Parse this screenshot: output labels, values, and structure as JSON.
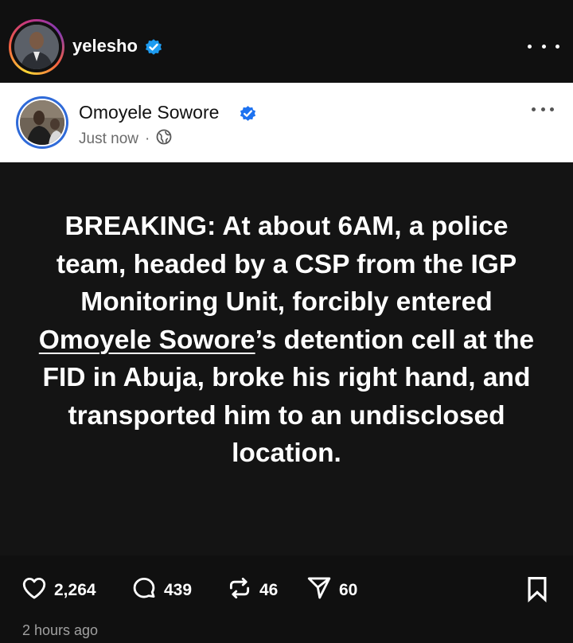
{
  "header": {
    "username": "yelesho",
    "verified": true
  },
  "embedded_post": {
    "author": "Omoyele Sowore",
    "verified": true,
    "time": "Just now",
    "separator": "·",
    "privacy_icon": "globe-icon"
  },
  "post": {
    "text_before": "BREAKING: At about 6AM, a police team, headed by a CSP from the IGP Monitoring Unit, forcibly entered ",
    "link_text": "Omoyele Sowore",
    "text_after": "’s detention cell at the FID in Abuja, broke his right hand, and transported him to an undisclosed location."
  },
  "actions": {
    "likes": "2,264",
    "replies": "439",
    "reposts": "46",
    "shares": "60"
  },
  "footer": {
    "time_ago": "2 hours ago"
  },
  "colors": {
    "background": "#101010",
    "card": "#ffffff",
    "verified": "#1d9bf0",
    "card_avatar_ring": "#2f6ad8"
  }
}
